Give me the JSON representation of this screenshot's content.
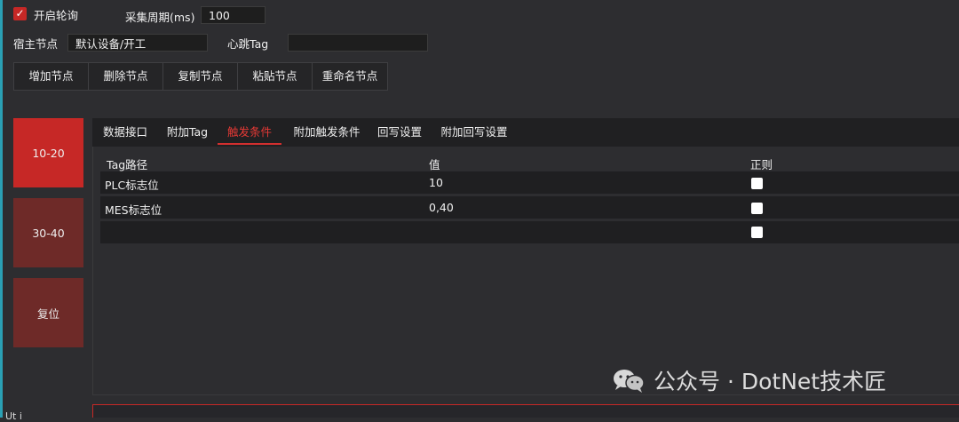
{
  "polling": {
    "enabled": true,
    "label": "开启轮询"
  },
  "period": {
    "label": "采集周期(ms)",
    "value": "100"
  },
  "host_node": {
    "label": "宿主节点",
    "value": "默认设备/开工"
  },
  "heartbeat": {
    "label": "心跳Tag",
    "value": ""
  },
  "toolbar": [
    "增加节点",
    "删除节点",
    "复制节点",
    "粘贴节点",
    "重命名节点"
  ],
  "side_buttons": [
    {
      "label": "10-20",
      "color": "#c62826"
    },
    {
      "label": "30-40",
      "color": "#6e2a28"
    },
    {
      "label": "复位",
      "color": "#6e2a28"
    }
  ],
  "tabs": [
    "数据接口",
    "附加Tag",
    "触发条件",
    "附加触发条件",
    "回写设置",
    "附加回写设置"
  ],
  "active_tab": "触发条件",
  "grid": {
    "columns": [
      "Tag路径",
      "值",
      "正则"
    ],
    "rows": [
      {
        "path": "PLC标志位",
        "value": "10",
        "regex": false
      },
      {
        "path": "MES标志位",
        "value": "0,40",
        "regex": false
      },
      {
        "path": "",
        "value": "",
        "regex": false
      }
    ]
  },
  "watermark": "公众号 · DotNet技术匠",
  "bottom_label": "Ut i",
  "colors": {
    "accent": "#c62826",
    "background": "#2d2d30",
    "row": "#1f1f21"
  }
}
